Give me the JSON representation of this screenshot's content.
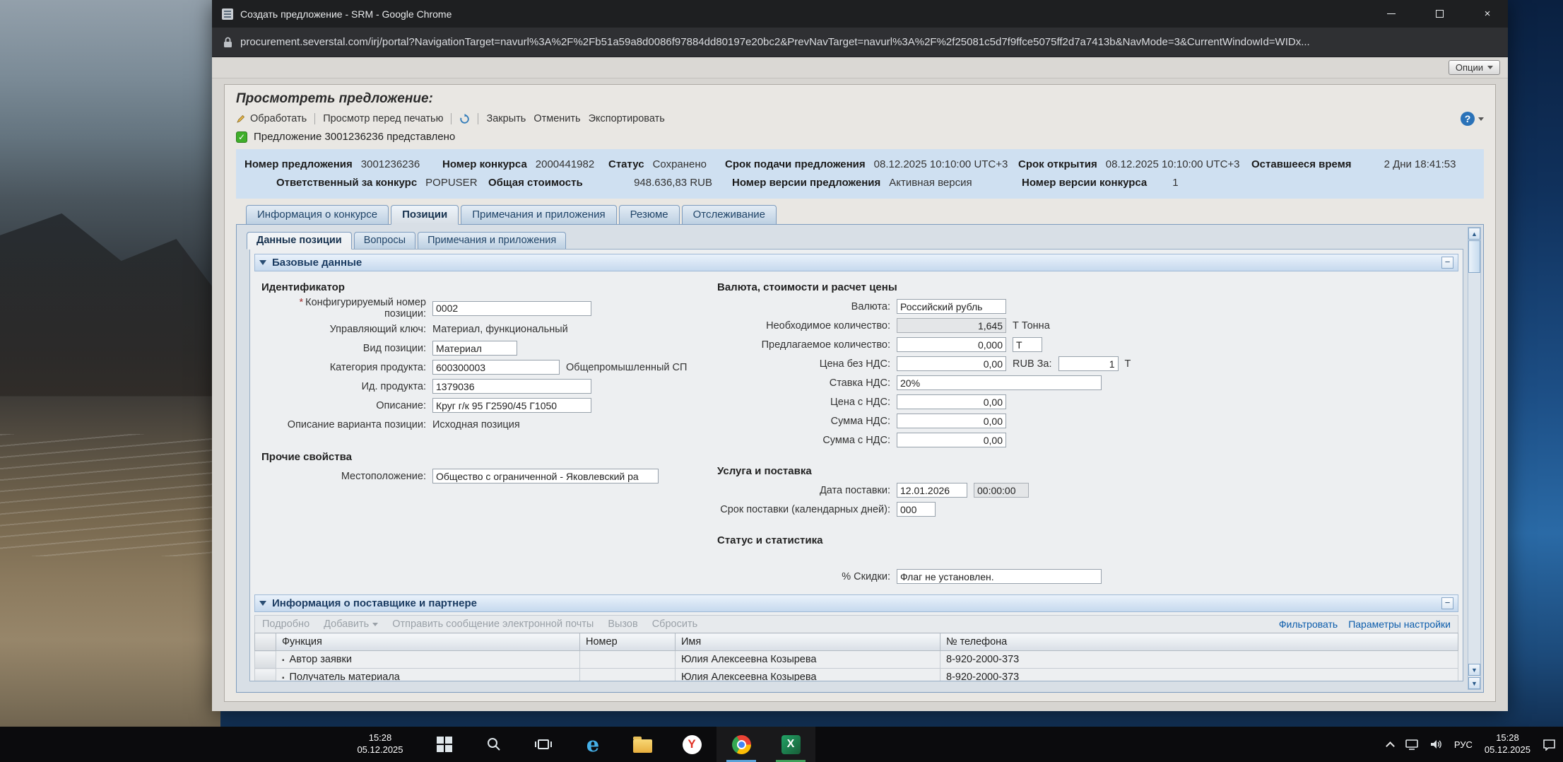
{
  "taskbar": {
    "clock_left": {
      "time": "15:28",
      "date": "05.12.2025"
    },
    "clock_right": {
      "time": "15:28",
      "date": "05.12.2025"
    },
    "language": "РУС"
  },
  "browser": {
    "window_title": "Создать предложение - SRM - Google Chrome",
    "url": "procurement.severstal.com/irj/portal?NavigationTarget=navurl%3A%2F%2Fb51a59a8d0086f97884dd80197e20bc2&PrevNavTarget=navurl%3A%2F%2f25081c5d7f9ffce5075ff2d7a7413b&NavMode=3&CurrentWindowId=WIDx..."
  },
  "portal": {
    "options": "Опции"
  },
  "icons": {
    "options_arrow": "▼",
    "collapse": "−",
    "bullet": "▪",
    "check": "✓",
    "help": "?",
    "scroll_up": "▲",
    "scroll_down": "▼",
    "section_arrow": "▼"
  },
  "app": {
    "title": "Просмотреть предложение:",
    "toolbar": {
      "edit": "Обработать",
      "print_preview": "Просмотр перед печатью",
      "close": "Закрыть",
      "cancel": "Отменить",
      "export": "Экспортировать"
    },
    "message": "Предложение 3001236236 представлено",
    "info": {
      "row1": [
        {
          "label": "Номер предложения",
          "value": "3001236236"
        },
        {
          "label": "Номер конкурса",
          "value": "2000441982"
        },
        {
          "label": "Статус",
          "value": "Сохранено"
        },
        {
          "label": "Срок подачи предложения",
          "value": "08.12.2025 10:10:00 UTC+3"
        },
        {
          "label": "Срок открытия",
          "value": "08.12.2025 10:10:00 UTC+3"
        },
        {
          "label": "Оставшееся время",
          "value": "2 Дни 18:41:53"
        }
      ],
      "row2": [
        {
          "label": "Ответственный за конкурс",
          "value": "POPUSER"
        },
        {
          "label": "Общая стоимость",
          "value": "948.636,83 RUB"
        },
        {
          "label": "Номер версии предложения",
          "value": "Активная версия"
        },
        {
          "label": "Номер версии конкурса",
          "value": "1"
        }
      ]
    },
    "tabs": [
      "Информация о конкурсе",
      "Позиции",
      "Примечания и приложения",
      "Резюме",
      "Отслеживание"
    ],
    "subtabs": [
      "Данные позиции",
      "Вопросы",
      "Примечания и приложения"
    ],
    "basic": {
      "title": "Базовые данные",
      "groups": {
        "identifier": "Идентификатор",
        "other": "Прочие свойства",
        "currency": "Валюта, стоимости и расчет цены",
        "delivery": "Услуга и поставка",
        "status": "Статус и статистика"
      },
      "fields": {
        "config_number": {
          "label": "Конфигурируемый номер позиции:",
          "value": "0002"
        },
        "control_key": {
          "label": "Управляющий ключ:",
          "value": "Материал, функциональный"
        },
        "item_type": {
          "label": "Вид позиции:",
          "value": "Материал"
        },
        "product_category": {
          "label": "Категория продукта:",
          "value": "600300003",
          "suffix": "Общепромышленный СП"
        },
        "product_id": {
          "label": "Ид. продукта:",
          "value": "1379036"
        },
        "description": {
          "label": "Описание:",
          "value": "Круг г/к 95 Г2590/45 Г1050"
        },
        "variant": {
          "label": "Описание варианта позиции:",
          "value": "Исходная позиция"
        },
        "location": {
          "label": "Местоположение:",
          "value": "Общество с ограниченной - Яковлевский ра"
        },
        "currency": {
          "label": "Валюта:",
          "value": "Российский рубль"
        },
        "required_qty": {
          "label": "Необходимое количество:",
          "value": "1,645",
          "suffix": "Т Тонна"
        },
        "offered_qty": {
          "label": "Предлагаемое количество:",
          "value": "0,000",
          "unit": "Т"
        },
        "net_price": {
          "label": "Цена без НДС:",
          "value": "0,00",
          "per_label": "RUB За:",
          "per_value": "1",
          "per_unit": "Т"
        },
        "vat_rate": {
          "label": "Ставка НДС:",
          "value": "20%"
        },
        "price_vat": {
          "label": "Цена с НДС:",
          "value": "0,00"
        },
        "vat_amount": {
          "label": "Сумма НДС:",
          "value": "0,00"
        },
        "total_vat": {
          "label": "Сумма с НДС:",
          "value": "0,00"
        },
        "delivery_date": {
          "label": "Дата поставки:",
          "value": "12.01.2026",
          "time": "00:00:00"
        },
        "delivery_days": {
          "label": "Срок поставки (календарных дней):",
          "value": "000"
        },
        "discount": {
          "label": "% Скидки:",
          "value": "Флаг не установлен."
        }
      }
    },
    "partner": {
      "title": "Информация о поставщике и партнере",
      "toolbar": [
        "Подробно",
        "Добавить",
        "Отправить сообщение электронной почты",
        "Вызов",
        "Сбросить"
      ],
      "links": [
        "Фильтровать",
        "Параметры настройки"
      ],
      "columns": [
        "Функция",
        "Номер",
        "Имя",
        "№ телефона"
      ],
      "rows": [
        [
          "Автор заявки",
          "",
          "Юлия Алексеевна Козырева",
          "8-920-2000-373"
        ],
        [
          "Получатель материала",
          "",
          "Юлия Алексеевна Козырева",
          "8-920-2000-373"
        ]
      ]
    }
  }
}
